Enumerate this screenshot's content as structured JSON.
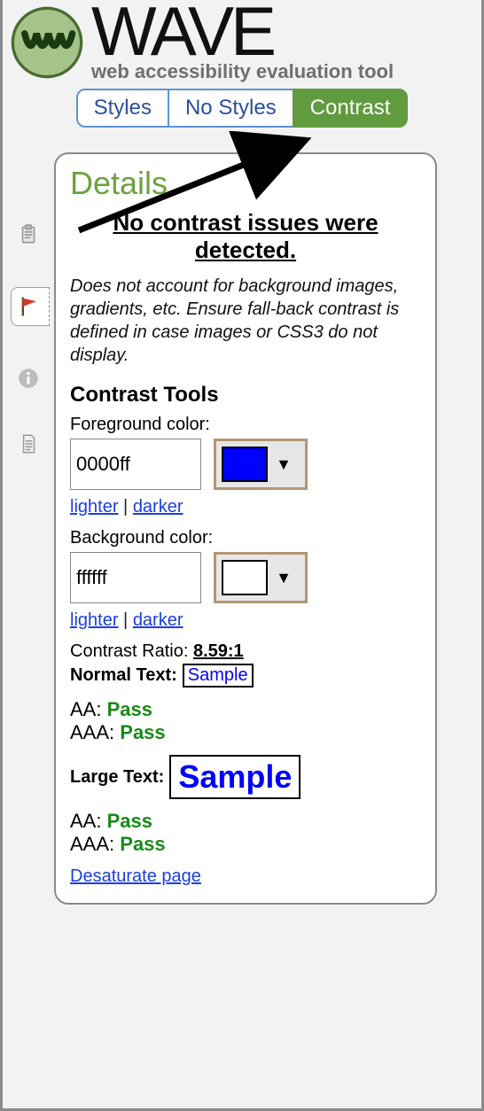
{
  "header": {
    "brand": "WAVE",
    "tagline": "web accessibility evaluation tool"
  },
  "tabs": {
    "styles": "Styles",
    "no_styles": "No Styles",
    "contrast": "Contrast"
  },
  "panel": {
    "title": "Details",
    "no_issues": "No contrast issues were detected.",
    "disclaimer": "Does not account for background images, gradients, etc. Ensure fall-back contrast is defined in case images or CSS3 do not display.",
    "tools_heading": "Contrast Tools",
    "fg": {
      "label": "Foreground color:",
      "value": "0000ff",
      "swatch_hex": "#0000ff",
      "lighter": "lighter",
      "darker": "darker"
    },
    "bg": {
      "label": "Background color:",
      "value": "ffffff",
      "swatch_hex": "#ffffff",
      "lighter": "lighter",
      "darker": "darker"
    },
    "ratio": {
      "label": "Contrast Ratio:",
      "value": "8.59:1"
    },
    "normal": {
      "label": "Normal Text:",
      "sample": "Sample",
      "aa_label": "AA:",
      "aa_result": "Pass",
      "aaa_label": "AAA:",
      "aaa_result": "Pass"
    },
    "large": {
      "label": "Large Text:",
      "sample": "Sample",
      "aa_label": "AA:",
      "aa_result": "Pass",
      "aaa_label": "AAA:",
      "aaa_result": "Pass"
    },
    "desaturate": "Desaturate page",
    "sep": " | "
  },
  "icons": {
    "clipboard": "clipboard-icon",
    "flag": "flag-icon",
    "info": "info-icon",
    "doc": "document-icon"
  }
}
